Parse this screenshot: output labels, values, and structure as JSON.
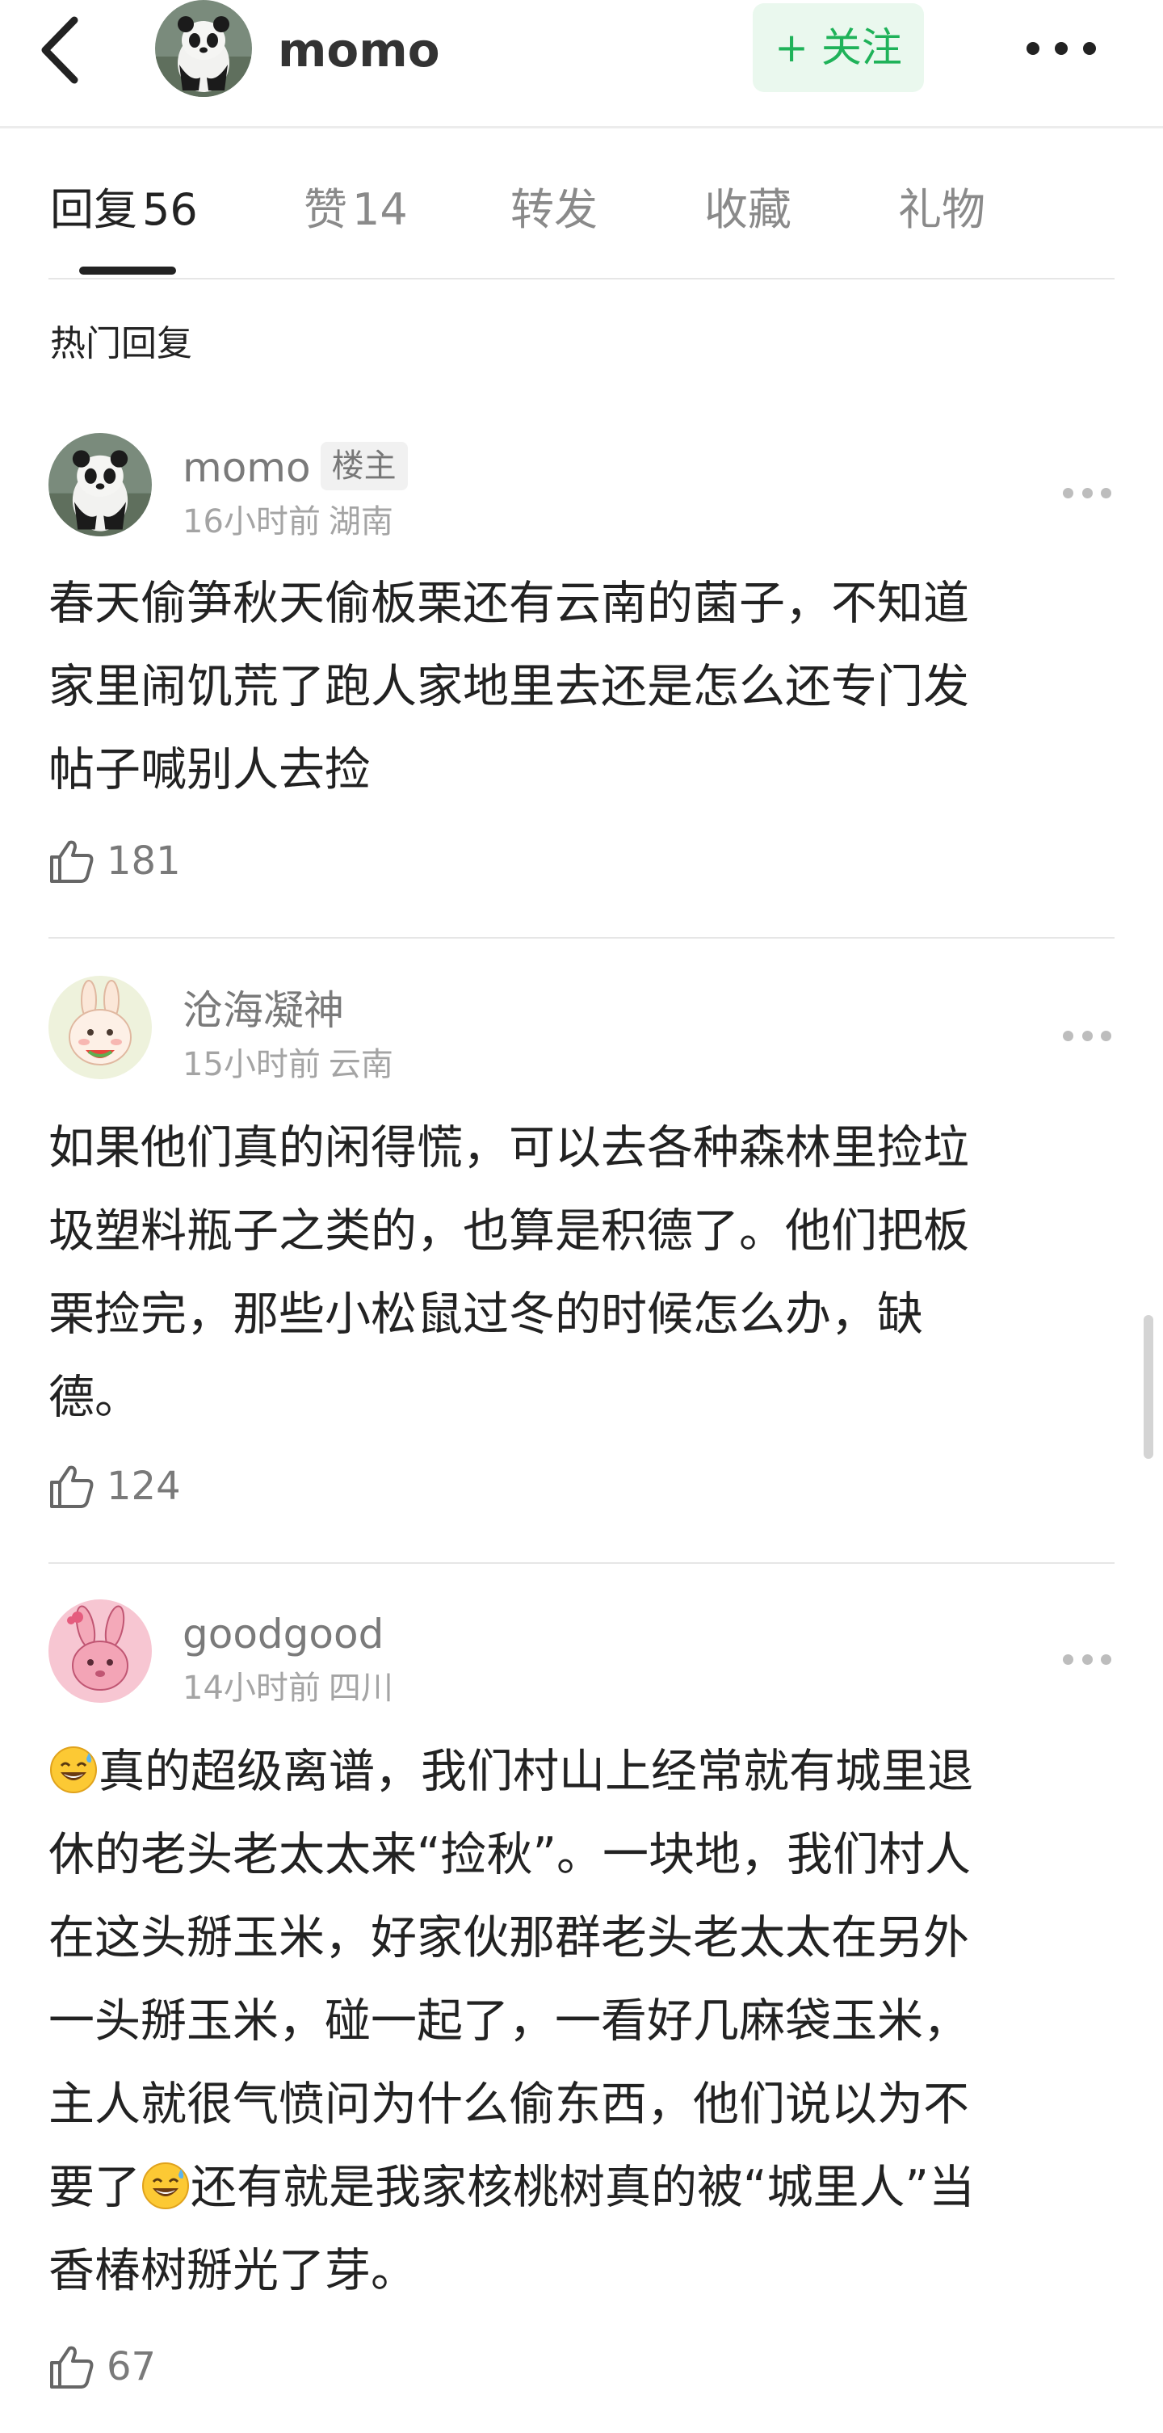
{
  "header": {
    "name": "momo",
    "follow_label": "+ 关注",
    "back_icon": "chevron-left-icon",
    "more_icon": "more-dots-icon"
  },
  "tabs": [
    {
      "label": "回复",
      "count": "56",
      "active": true
    },
    {
      "label": "赞",
      "count": "14",
      "active": false
    },
    {
      "label": "转发",
      "count": "",
      "active": false
    },
    {
      "label": "收藏",
      "count": "",
      "active": false
    },
    {
      "label": "礼物",
      "count": "",
      "active": false
    }
  ],
  "section_title": "热门回复",
  "comments": [
    {
      "name": "momo",
      "badge": "楼主",
      "time": "16小时前",
      "location": "湖南",
      "text": "春天偷笋秋天偷板栗还有云南的菌子，不知道\n家里闹饥荒了跑人家地里去还是怎么还专门发\n帖子喊别人去捡",
      "likes": "181",
      "avatar_icon": "panda-avatar-icon"
    },
    {
      "name": "沧海凝神",
      "badge": "",
      "time": "15小时前",
      "location": "云南",
      "text": "如果他们真的闲得慌，可以去各种森林里捡垃\n圾塑料瓶子之类的，也算是积德了。他们把板\n栗捡完，那些小松鼠过冬的时候怎么办，缺\n德。",
      "likes": "124",
      "avatar_icon": "bunny-avatar-icon"
    },
    {
      "name": "goodgood",
      "badge": "",
      "time": "14小时前",
      "location": "四川",
      "text_line1": "真的超级离谱，我们村山上经常就有城里退",
      "text_middle": "休的老头老太太来“捡秋”。一块地，我们村人\n在这头掰玉米，好家伙那群老头老太太在另外\n一头掰玉米，碰一起了，一看好几麻袋玉米，\n主人就很气愤问为什么偷东西，他们说以为不",
      "text_line6a": "要了",
      "text_line6b": "还有就是我家核桃树真的被“城里人”当",
      "text_last": "香椿树掰光了芽。",
      "likes": "67",
      "avatar_icon": "pink-rabbit-avatar-icon",
      "emoji_icon": "sweat-smile-emoji-icon"
    }
  ],
  "colors": {
    "follow_green": "#1fb259",
    "follow_bg": "#eaf8ee",
    "muted": "#a4a4a4"
  }
}
